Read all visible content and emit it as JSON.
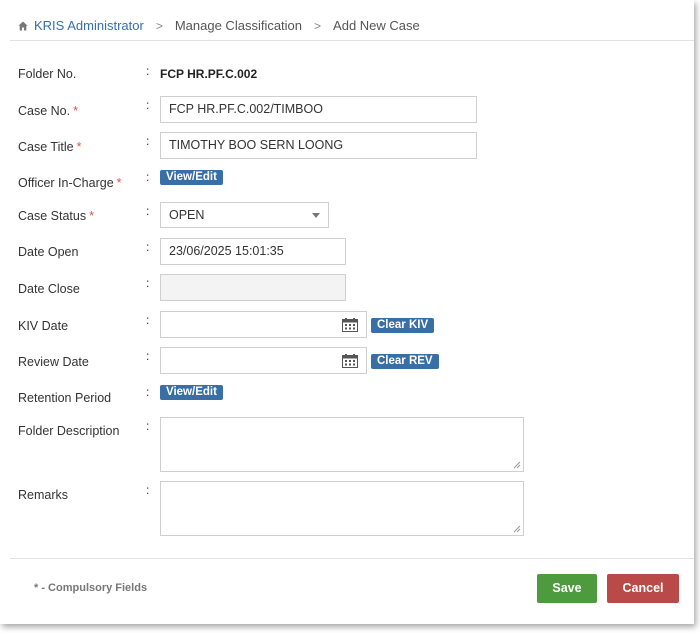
{
  "breadcrumb": {
    "items": [
      "KRIS Administrator",
      "Manage Classification",
      "Add New Case"
    ],
    "separator": ">"
  },
  "form": {
    "colon": ":",
    "required_mark": "*",
    "folder_no": {
      "label": "Folder No.",
      "value": "FCP HR.PF.C.002"
    },
    "case_no": {
      "label": "Case No.",
      "value": "FCP HR.PF.C.002/TIMBOO"
    },
    "case_title": {
      "label": "Case Title",
      "value": "TIMOTHY BOO SERN LOONG"
    },
    "officer_in_charge": {
      "label": "Officer In-Charge",
      "button": "View/Edit"
    },
    "case_status": {
      "label": "Case Status",
      "value": "OPEN"
    },
    "date_open": {
      "label": "Date Open",
      "value": "23/06/2025 15:01:35"
    },
    "date_close": {
      "label": "Date Close",
      "value": ""
    },
    "kiv_date": {
      "label": "KIV Date",
      "value": "",
      "clear_button": "Clear KIV"
    },
    "review_date": {
      "label": "Review Date",
      "value": "",
      "clear_button": "Clear REV"
    },
    "retention_period": {
      "label": "Retention Period",
      "button": "View/Edit"
    },
    "folder_description": {
      "label": "Folder Description",
      "value": ""
    },
    "remarks": {
      "label": "Remarks",
      "value": ""
    }
  },
  "footer": {
    "note": "* - Compulsory Fields",
    "save_label": "Save",
    "cancel_label": "Cancel"
  },
  "colors": {
    "link": "#3a6fa6",
    "badge": "#3a6fa6",
    "required": "#d9534f",
    "save": "#4e9a3f",
    "cancel": "#b94a48"
  }
}
